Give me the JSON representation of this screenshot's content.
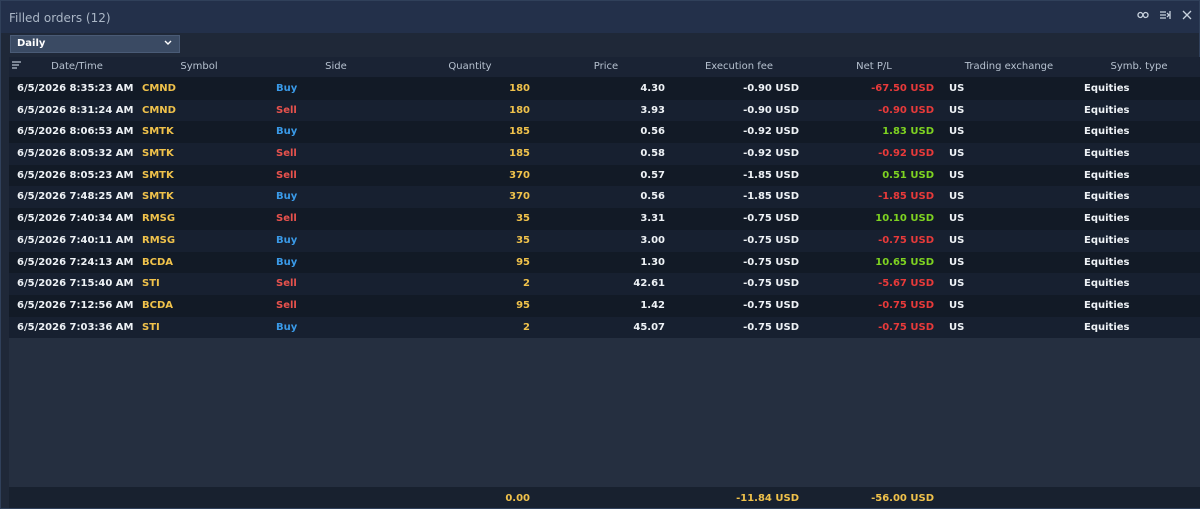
{
  "window": {
    "title": "Filled orders (12)",
    "icons": [
      "link-icon",
      "column-settings-icon",
      "close-icon"
    ]
  },
  "period_select": {
    "value": "Daily"
  },
  "columns": [
    "Date/Time",
    "Symbol",
    "Side",
    "Quantity",
    "Price",
    "Execution fee",
    "Net P/L",
    "Trading exchange",
    "Symb. type"
  ],
  "rows": [
    {
      "datetime": "6/5/2026 8:35:23 AM",
      "symbol": "CMND",
      "side": "Buy",
      "quantity": "180",
      "price": "4.30",
      "fee": "-0.90 USD",
      "pnl_value": "-67.50",
      "pnl_currency": "USD",
      "pnl_sign": "neg",
      "exchange": "US",
      "type": "Equities"
    },
    {
      "datetime": "6/5/2026 8:31:24 AM",
      "symbol": "CMND",
      "side": "Sell",
      "quantity": "180",
      "price": "3.93",
      "fee": "-0.90 USD",
      "pnl_value": "-0.90",
      "pnl_currency": "USD",
      "pnl_sign": "neg",
      "exchange": "US",
      "type": "Equities"
    },
    {
      "datetime": "6/5/2026 8:06:53 AM",
      "symbol": "SMTK",
      "side": "Buy",
      "quantity": "185",
      "price": "0.56",
      "fee": "-0.92 USD",
      "pnl_value": "1.83",
      "pnl_currency": "USD",
      "pnl_sign": "pos",
      "exchange": "US",
      "type": "Equities"
    },
    {
      "datetime": "6/5/2026 8:05:32 AM",
      "symbol": "SMTK",
      "side": "Sell",
      "quantity": "185",
      "price": "0.58",
      "fee": "-0.92 USD",
      "pnl_value": "-0.92",
      "pnl_currency": "USD",
      "pnl_sign": "neg",
      "exchange": "US",
      "type": "Equities"
    },
    {
      "datetime": "6/5/2026 8:05:23 AM",
      "symbol": "SMTK",
      "side": "Sell",
      "quantity": "370",
      "price": "0.57",
      "fee": "-1.85 USD",
      "pnl_value": "0.51",
      "pnl_currency": "USD",
      "pnl_sign": "pos",
      "exchange": "US",
      "type": "Equities"
    },
    {
      "datetime": "6/5/2026 7:48:25 AM",
      "symbol": "SMTK",
      "side": "Buy",
      "quantity": "370",
      "price": "0.56",
      "fee": "-1.85 USD",
      "pnl_value": "-1.85",
      "pnl_currency": "USD",
      "pnl_sign": "neg",
      "exchange": "US",
      "type": "Equities"
    },
    {
      "datetime": "6/5/2026 7:40:34 AM",
      "symbol": "RMSG",
      "side": "Sell",
      "quantity": "35",
      "price": "3.31",
      "fee": "-0.75 USD",
      "pnl_value": "10.10",
      "pnl_currency": "USD",
      "pnl_sign": "pos",
      "exchange": "US",
      "type": "Equities"
    },
    {
      "datetime": "6/5/2026 7:40:11 AM",
      "symbol": "RMSG",
      "side": "Buy",
      "quantity": "35",
      "price": "3.00",
      "fee": "-0.75 USD",
      "pnl_value": "-0.75",
      "pnl_currency": "USD",
      "pnl_sign": "neg",
      "exchange": "US",
      "type": "Equities"
    },
    {
      "datetime": "6/5/2026 7:24:13 AM",
      "symbol": "BCDA",
      "side": "Buy",
      "quantity": "95",
      "price": "1.30",
      "fee": "-0.75 USD",
      "pnl_value": "10.65",
      "pnl_currency": "USD",
      "pnl_sign": "pos",
      "exchange": "US",
      "type": "Equities"
    },
    {
      "datetime": "6/5/2026 7:15:40 AM",
      "symbol": "STI",
      "side": "Sell",
      "quantity": "2",
      "price": "42.61",
      "fee": "-0.75 USD",
      "pnl_value": "-5.67",
      "pnl_currency": "USD",
      "pnl_sign": "neg",
      "exchange": "US",
      "type": "Equities"
    },
    {
      "datetime": "6/5/2026 7:12:56 AM",
      "symbol": "BCDA",
      "side": "Sell",
      "quantity": "95",
      "price": "1.42",
      "fee": "-0.75 USD",
      "pnl_value": "-0.75",
      "pnl_currency": "USD",
      "pnl_sign": "neg",
      "exchange": "US",
      "type": "Equities"
    },
    {
      "datetime": "6/5/2026 7:03:36 AM",
      "symbol": "STI",
      "side": "Buy",
      "quantity": "2",
      "price": "45.07",
      "fee": "-0.75 USD",
      "pnl_value": "-0.75",
      "pnl_currency": "USD",
      "pnl_sign": "neg",
      "exchange": "US",
      "type": "Equities"
    }
  ],
  "totals": {
    "quantity": "0.00",
    "fee": "-11.84 USD",
    "pnl": "-56.00 USD"
  },
  "colors": {
    "buy": "#3a9ae8",
    "sell": "#e8524d",
    "positive": "#7ed321",
    "negative": "#e83a3a",
    "symbol": "#f0c24b"
  }
}
